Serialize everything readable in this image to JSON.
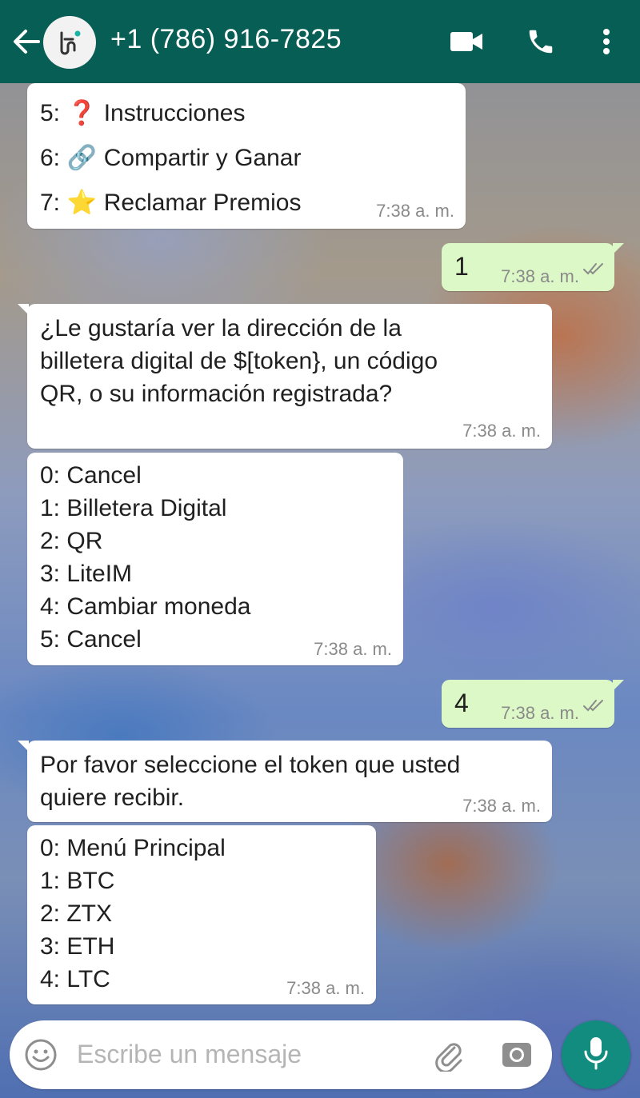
{
  "header": {
    "contact_name": "+1 (786) 916-7825",
    "back_icon": "back-arrow-icon",
    "video_icon": "video-call-icon",
    "call_icon": "phone-icon",
    "menu_icon": "more-vert-icon",
    "background_color": "#075e54"
  },
  "messages": [
    {
      "direction": "incoming",
      "lines": [
        {
          "prefix": "5:",
          "emoji": "❓",
          "text": "Instrucciones"
        },
        {
          "prefix": "6:",
          "emoji": "🔗",
          "text": "Compartir y Ganar"
        },
        {
          "prefix": "7:",
          "emoji": "⭐",
          "text": "Reclamar Premios"
        }
      ],
      "time": "7:38 a. m."
    },
    {
      "direction": "outgoing",
      "text": "1",
      "time": "7:38 a. m.",
      "status_icon": "double-check-icon"
    },
    {
      "direction": "incoming",
      "lines": [
        "¿Le gustaría ver la dirección de la",
        "billetera digital de $[token}, un código",
        "QR, o su información registrada?"
      ],
      "time": "7:38 a. m."
    },
    {
      "direction": "incoming",
      "lines": [
        "0: Cancel",
        "1: Billetera Digital",
        "2: QR",
        "3: LiteIM",
        "4: Cambiar moneda",
        "5: Cancel"
      ],
      "time": "7:38 a. m."
    },
    {
      "direction": "outgoing",
      "text": "4",
      "time": "7:38 a. m.",
      "status_icon": "double-check-icon"
    },
    {
      "direction": "incoming",
      "lines": [
        "Por favor seleccione el token que usted",
        "quiere recibir."
      ],
      "time": "7:38 a. m."
    },
    {
      "direction": "incoming",
      "lines": [
        "0: Menú Principal",
        "1: BTC",
        "2: ZTX",
        "3: ETH",
        "4: LTC"
      ],
      "time": "7:38 a. m."
    }
  ],
  "input": {
    "placeholder": "Escribe un mensaje",
    "emoji_icon": "emoji-icon",
    "attach_icon": "paperclip-icon",
    "camera_icon": "camera-icon",
    "mic_icon": "microphone-icon"
  },
  "colors": {
    "incoming_bubble": "#ffffff",
    "outgoing_bubble": "#dcf8c6",
    "mic_button": "#128c7e",
    "read_ticks": "#8a8a8a"
  }
}
